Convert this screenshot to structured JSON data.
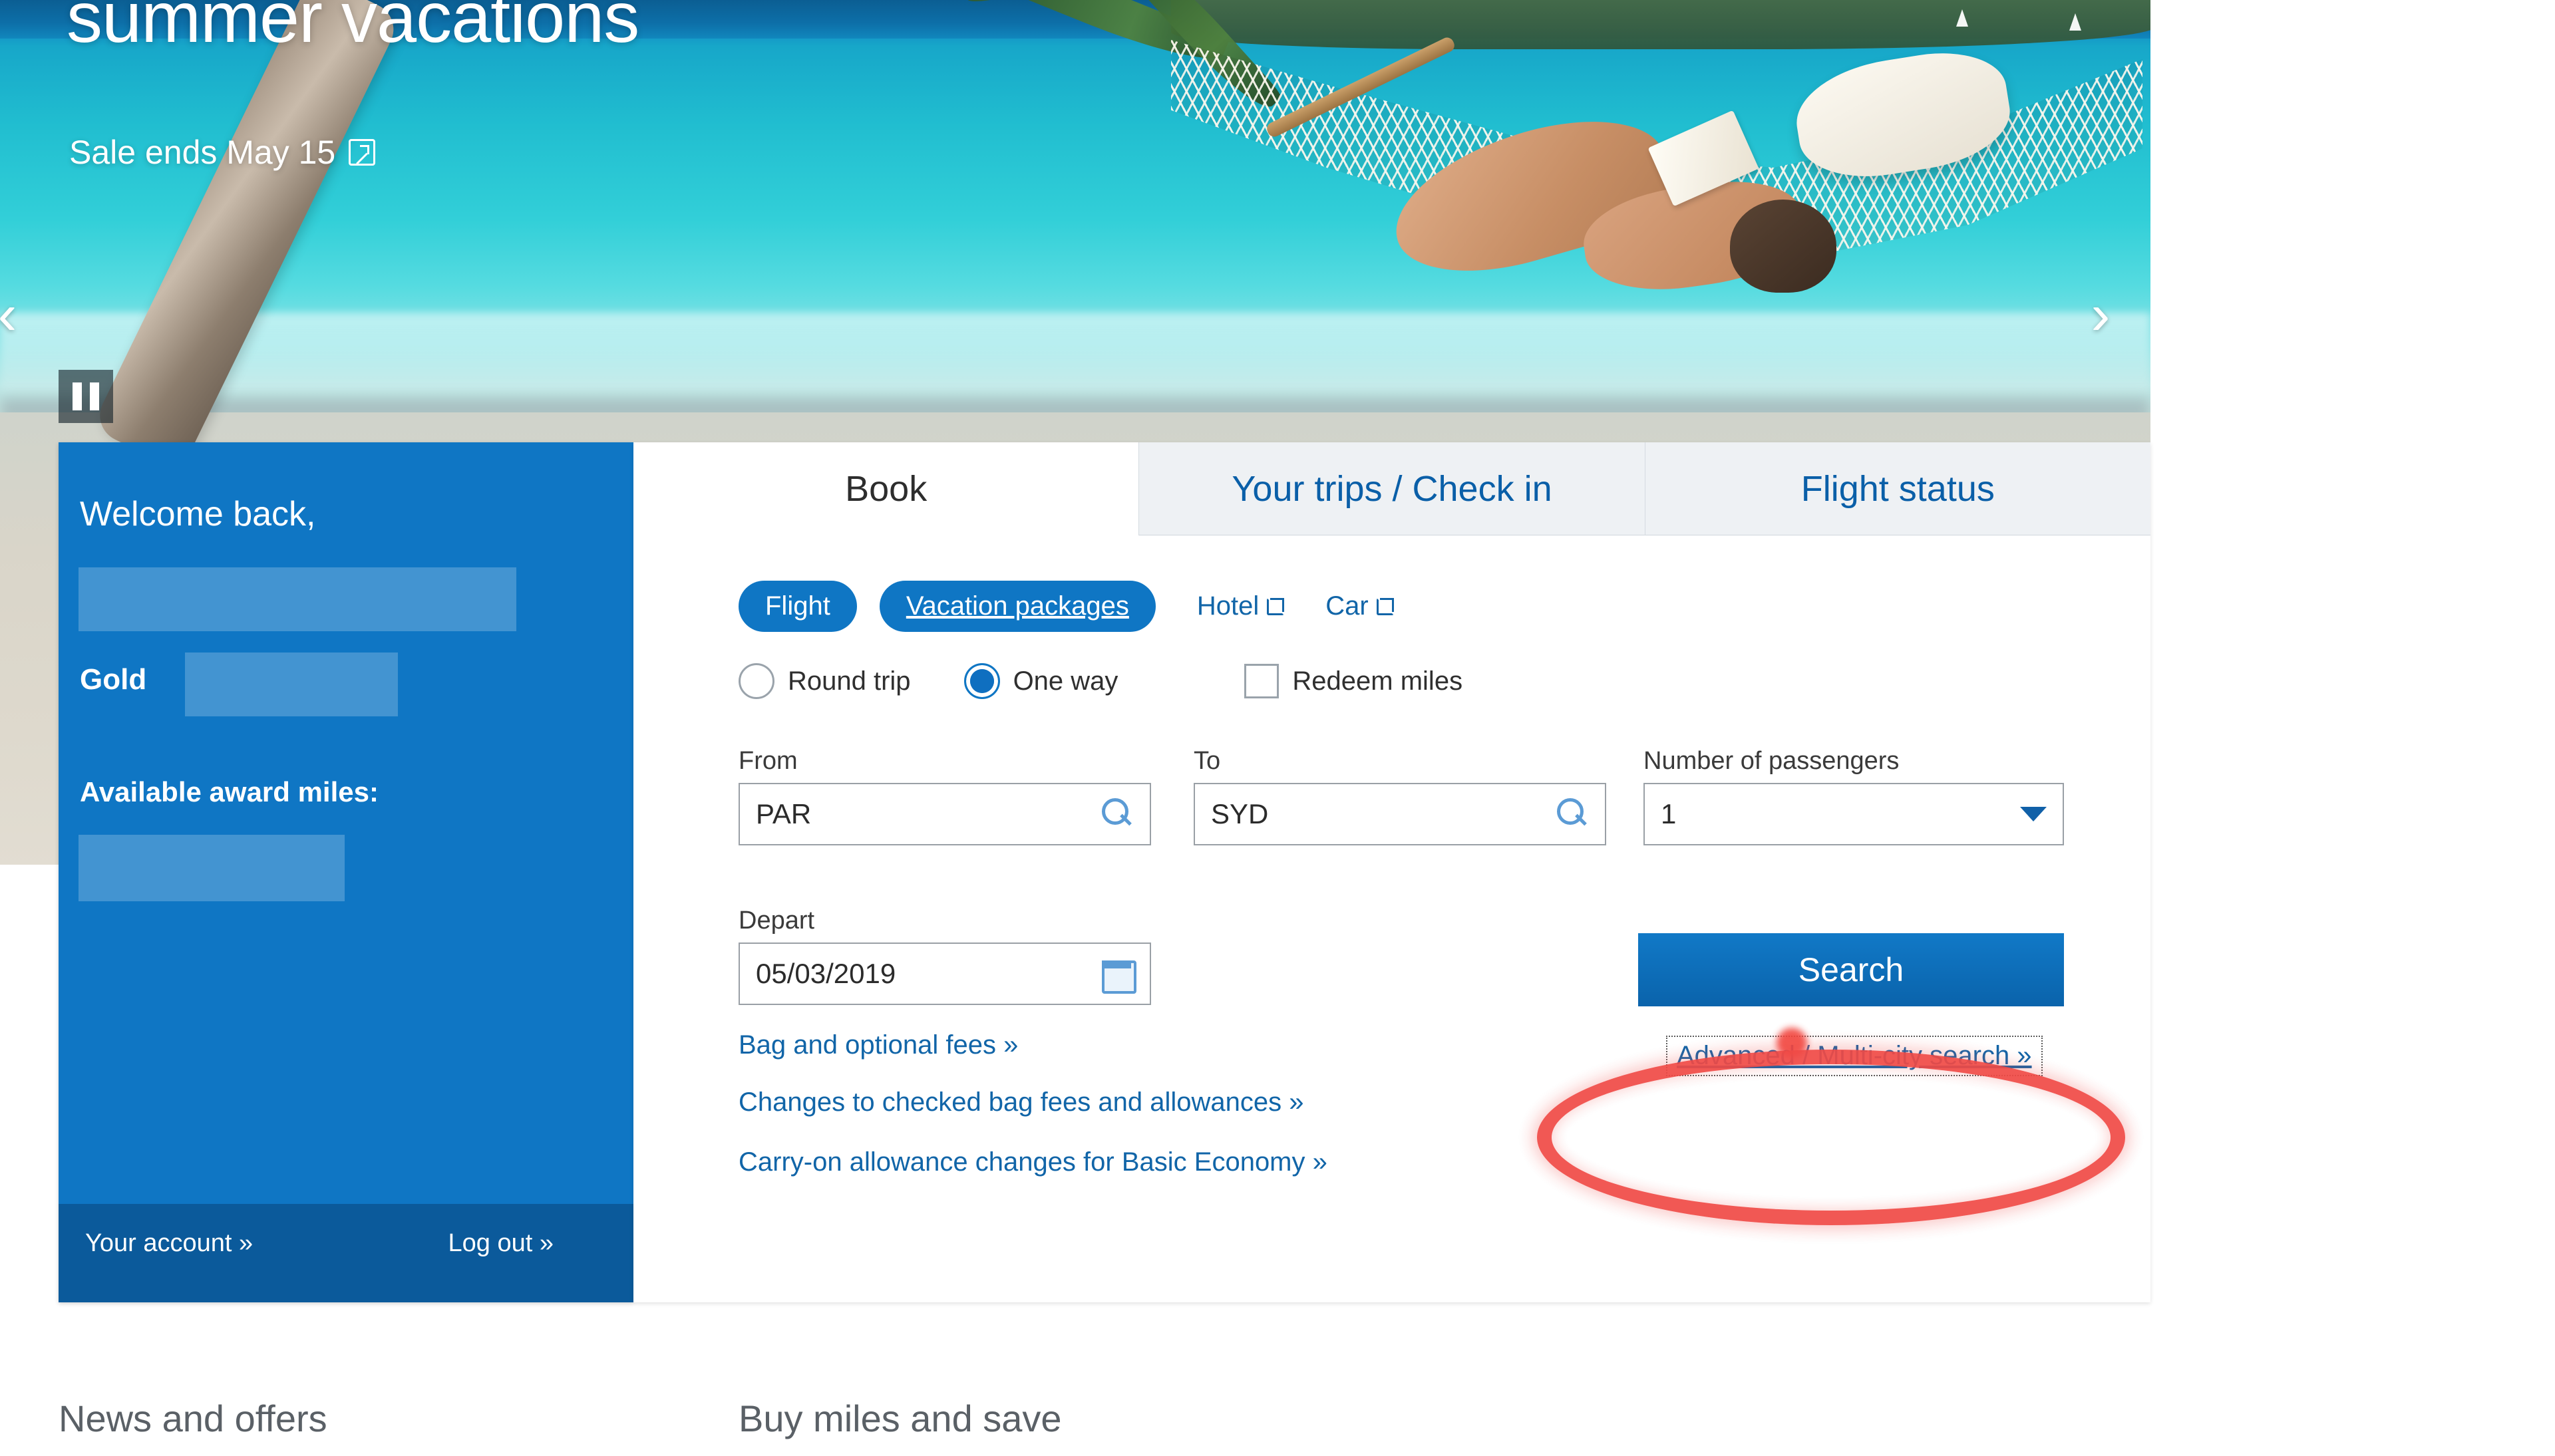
{
  "hero": {
    "title": "summer vacations",
    "subtitle": "Sale ends May 15",
    "subtitle_icon": "external-link-icon",
    "prev_label": "‹",
    "next_label": "›",
    "pause_label": "pause-icon"
  },
  "sidebar": {
    "welcome": "Welcome back,",
    "member_name_redacted": "",
    "tier_label": "Gold",
    "tier_value_redacted": "",
    "miles_label": "Available award miles:",
    "miles_value_redacted": "",
    "account_link": "Your account »",
    "logout_link": "Log out »"
  },
  "panel": {
    "tabs": [
      {
        "label": "Book",
        "active": true
      },
      {
        "label": "Your trips / Check in",
        "active": false
      },
      {
        "label": "Flight status",
        "active": false
      }
    ],
    "product_pills": [
      {
        "label": "Flight",
        "style": "pill",
        "focused": false
      },
      {
        "label": "Vacation packages",
        "style": "pill",
        "focused": true
      },
      {
        "label": "Hotel",
        "style": "link",
        "icon": "external-link-icon"
      },
      {
        "label": "Car",
        "style": "link",
        "icon": "external-link-icon"
      }
    ],
    "trip_type": {
      "round_trip_label": "Round trip",
      "round_trip_selected": false,
      "one_way_label": "One way",
      "one_way_selected": true
    },
    "redeem_miles": {
      "label": "Redeem miles",
      "checked": false
    },
    "fields": {
      "from_label": "From",
      "from_value": "PAR",
      "to_label": "To",
      "to_value": "SYD",
      "passengers_label": "Number of passengers",
      "passengers_value": "1",
      "depart_label": "Depart",
      "depart_value": "05/03/2019"
    },
    "search_button": "Search",
    "advanced_link": "Advanced / Multi-city search »",
    "footer_links": [
      "Bag and optional fees »",
      "Changes to checked bag fees and allowances »",
      "Carry-on allowance changes for Basic Economy »"
    ]
  },
  "below_fold": {
    "news_heading": "News and offers",
    "miles_heading": "Buy miles and save"
  },
  "colors": {
    "brand_blue": "#0f76c4",
    "brand_blue_dark": "#0b5a9b",
    "link_blue": "#1165a8",
    "annotation_red": "#f04a46"
  }
}
